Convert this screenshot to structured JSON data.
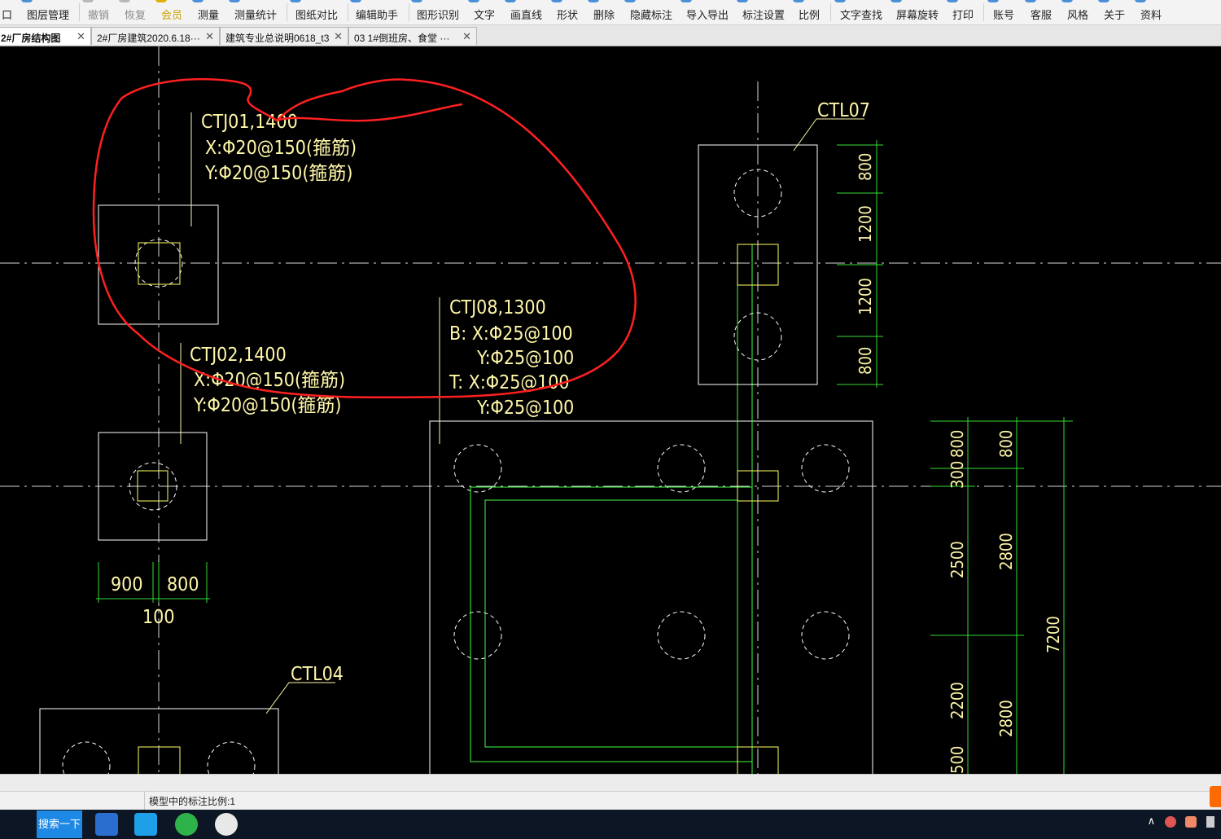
{
  "toolbar": {
    "items": [
      {
        "label": "口",
        "state": "normal"
      },
      {
        "label": "图层管理",
        "state": "normal"
      },
      {
        "label": "撤销",
        "state": "disabled"
      },
      {
        "label": "恢复",
        "state": "disabled"
      },
      {
        "label": "会员",
        "state": "vip"
      },
      {
        "label": "测量",
        "state": "normal"
      },
      {
        "label": "测量统计",
        "state": "normal"
      },
      {
        "label": "图纸对比",
        "state": "normal"
      },
      {
        "label": "编辑助手",
        "state": "normal"
      },
      {
        "label": "图形识别",
        "state": "normal"
      },
      {
        "label": "文字",
        "state": "normal"
      },
      {
        "label": "画直线",
        "state": "normal"
      },
      {
        "label": "形状",
        "state": "normal"
      },
      {
        "label": "删除",
        "state": "normal"
      },
      {
        "label": "隐藏标注",
        "state": "normal"
      },
      {
        "label": "导入导出",
        "state": "normal"
      },
      {
        "label": "标注设置",
        "state": "normal"
      },
      {
        "label": "比例",
        "state": "normal"
      },
      {
        "label": "文字查找",
        "state": "normal"
      },
      {
        "label": "屏幕旋转",
        "state": "normal"
      },
      {
        "label": "打印",
        "state": "normal"
      },
      {
        "label": "账号",
        "state": "normal"
      },
      {
        "label": "客服",
        "state": "normal"
      },
      {
        "label": "风格",
        "state": "normal"
      },
      {
        "label": "关于",
        "state": "normal"
      },
      {
        "label": "资料",
        "state": "normal"
      }
    ]
  },
  "tabs": [
    {
      "label": "2#厂房结构图",
      "active": true
    },
    {
      "label": "2#厂房建筑2020.6.18···",
      "active": false
    },
    {
      "label": "建筑专业总说明0618_t3",
      "active": false
    },
    {
      "label": "03 1#倒班房、食堂 ···",
      "active": false
    }
  ],
  "tab_close_glyph": "✕",
  "drawing": {
    "ctj01": {
      "title": "CTJ01,1400",
      "x": "X:Φ20@150(箍筋)",
      "y": "Y:Φ20@150(箍筋)"
    },
    "ctj02": {
      "title": "CTJ02,1400",
      "x": "X:Φ20@150(箍筋)",
      "y": "Y:Φ20@150(箍筋)"
    },
    "ctj08": {
      "title": "CTJ08,1300",
      "bx": "B: X:Φ25@100",
      "by": "Y:Φ25@100",
      "tx": "T: X:Φ25@100",
      "ty": "Y:Φ25@100"
    },
    "ctl07": "CTL07",
    "ctl04": "CTL04",
    "dims_left": [
      "900",
      "800",
      "100"
    ],
    "dims_ctl07": [
      "800",
      "1200",
      "1200",
      "800"
    ],
    "dims_right_inner": [
      "800",
      "300",
      "2500",
      "2200",
      "500"
    ],
    "dims_right_outer": [
      "800",
      "2800",
      "2800"
    ],
    "dims_total": "7200"
  },
  "colors": {
    "line": "#ffffff",
    "text": "#fff7a8",
    "column": "#ffff66",
    "dim": "#33dd33",
    "beam": "#44ff44",
    "axis": "#d8d8d8",
    "markup": "#ff2020"
  },
  "status": {
    "scale_text": "模型中的标注比例:1"
  },
  "taskbar": {
    "search_label": "搜索一下",
    "tray_arrow": "∧"
  }
}
